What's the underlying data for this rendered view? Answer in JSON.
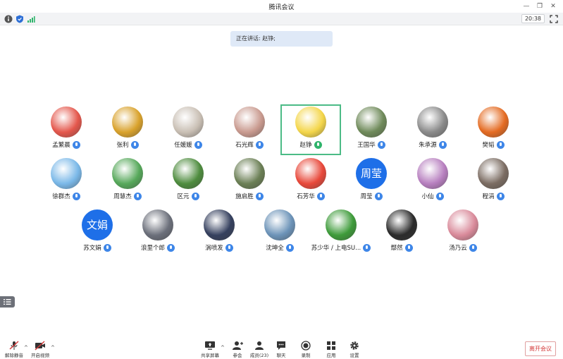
{
  "window": {
    "title": "腾讯会议"
  },
  "status": {
    "time": "20:38"
  },
  "banner": {
    "speaking_text": "正在讲话: 赵铮;"
  },
  "participants": [
    {
      "name": "孟繁晨",
      "mic": "blue",
      "avatar": "photo",
      "color": "#e4574c"
    },
    {
      "name": "张利",
      "mic": "blue",
      "avatar": "photo",
      "color": "#d9a22c"
    },
    {
      "name": "任媛媛",
      "mic": "blue",
      "avatar": "photo",
      "color": "#c9bfb4"
    },
    {
      "name": "石光辉",
      "mic": "blue",
      "avatar": "photo",
      "color": "#c99a8f"
    },
    {
      "name": "赵铮",
      "mic": "green",
      "avatar": "photo",
      "color": "#f4d64a",
      "active": true
    },
    {
      "name": "王国华",
      "mic": "blue",
      "avatar": "photo",
      "color": "#6f8a5a"
    },
    {
      "name": "朱承源",
      "mic": "blue",
      "avatar": "photo",
      "color": "#8a8a8a"
    },
    {
      "name": "樊韬",
      "mic": "blue",
      "avatar": "photo",
      "color": "#e46b22"
    },
    {
      "name": "徐群杰",
      "mic": "blue",
      "avatar": "photo",
      "color": "#7ab8e8"
    },
    {
      "name": "周慧杰",
      "mic": "blue",
      "avatar": "photo",
      "color": "#56a85a"
    },
    {
      "name": "区元",
      "mic": "blue",
      "avatar": "photo",
      "color": "#4e8c3e"
    },
    {
      "name": "施启胜",
      "mic": "blue",
      "avatar": "photo",
      "color": "#6b7f55"
    },
    {
      "name": "石芳华",
      "mic": "blue",
      "avatar": "photo",
      "color": "#e8483a"
    },
    {
      "name": "周莹",
      "mic": "blue",
      "avatar": "text",
      "avatar_text": "周莹",
      "color": "#1e6fe8"
    },
    {
      "name": "小仙",
      "mic": "blue",
      "avatar": "photo",
      "color": "#b77fbf"
    },
    {
      "name": "程涓",
      "mic": "blue",
      "avatar": "photo",
      "color": "#7b6c62"
    },
    {
      "name": "苏文娟",
      "mic": "blue",
      "avatar": "text",
      "avatar_text": "文娟",
      "color": "#1e6fe8"
    },
    {
      "name": "浪里个郎",
      "mic": "blue",
      "avatar": "photo",
      "color": "#6b6f7a"
    },
    {
      "name": "涡喷发",
      "mic": "blue",
      "avatar": "photo",
      "color": "#35405e"
    },
    {
      "name": "沈坤全",
      "mic": "blue",
      "avatar": "photo",
      "color": "#6c93b8"
    },
    {
      "name": "苏少华 / 上电SU...",
      "mic": "blue",
      "avatar": "photo",
      "color": "#3e9b3a"
    },
    {
      "name": "鄢然",
      "mic": "blue",
      "avatar": "photo",
      "color": "#2b2b2b"
    },
    {
      "name": "汤乃云",
      "mic": "blue",
      "avatar": "photo",
      "color": "#d98a9a"
    }
  ],
  "toolbar": {
    "unmute": "解除静音",
    "video": "开启视频",
    "share": "共享屏幕",
    "members": "参会",
    "manage": "成员(23)",
    "chat": "聊天",
    "record": "录制",
    "apps": "应用",
    "settings": "设置",
    "leave": "离开会议"
  },
  "colors": {
    "accent": "#1e6fe8",
    "active_border": "#4cbb86",
    "leave": "#d43a3a"
  }
}
